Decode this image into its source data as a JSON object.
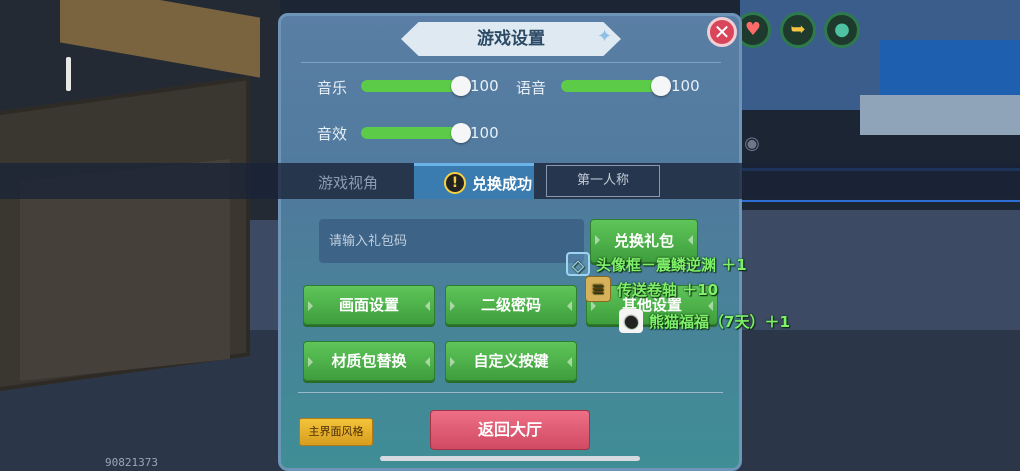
{
  "dialog": {
    "title": "游戏设置",
    "close_icon": "close-icon"
  },
  "audio": {
    "music_label": "音乐",
    "music_value": "100",
    "music_level": 1.0,
    "voice_label": "语音",
    "voice_value": "100",
    "voice_level": 1.0,
    "sfx_label": "音效",
    "sfx_value": "100",
    "sfx_level": 1.0
  },
  "view": {
    "label": "游戏视角",
    "first_person": "第一人称"
  },
  "toast": {
    "icon": "warning-icon",
    "text": "兑换成功"
  },
  "gift": {
    "placeholder": "请输入礼包码",
    "redeem_label": "兑换礼包"
  },
  "buttons": {
    "graphics": "画面设置",
    "second_password": "二级密码",
    "other": "其他设置",
    "texture_pack": "材质包替换",
    "custom_keys": "自定义按键",
    "home_style": "主界面风格",
    "back_lobby": "返回大厅"
  },
  "rewards": [
    {
      "icon": "avatar-frame-icon",
      "text": "头像框－震鳞逆渊 ＋1"
    },
    {
      "icon": "teleport-scroll-icon",
      "text": "传送卷轴 ＋10"
    },
    {
      "icon": "panda-icon",
      "text": "熊猫福福（7天）＋1"
    }
  ],
  "hud": {
    "uid": "90821373",
    "icons": [
      "heart-icon",
      "arrow-icon",
      "drop-icon",
      "eye-icon"
    ]
  },
  "colors": {
    "slider_fill": "#5ccc48",
    "button_green": "#4cb449",
    "back_pink": "#e05c75",
    "style_gold": "#e8b02c",
    "reward_green": "#7ef06a"
  }
}
